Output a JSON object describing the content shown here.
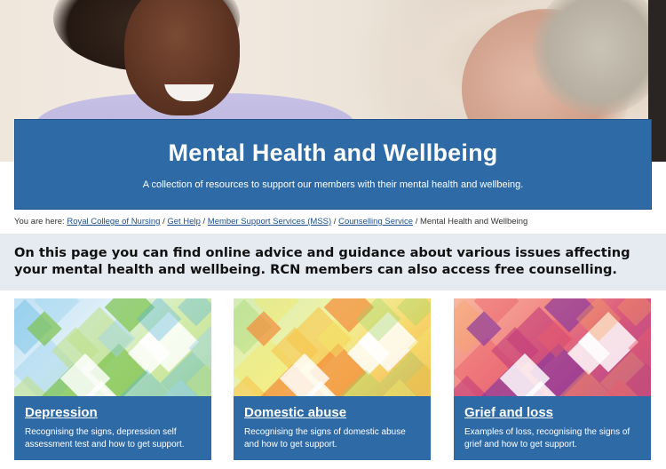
{
  "hero": {
    "title": "Mental Health and Wellbeing",
    "subtitle": "A collection of resources to support our members with their mental health and wellbeing.",
    "banner_color": "#2e6aa6"
  },
  "breadcrumb": {
    "prefix": "You are here:",
    "items": [
      {
        "label": "Royal College of Nursing",
        "link": true
      },
      {
        "label": "Get Help",
        "link": true
      },
      {
        "label": "Member Support Services (MSS)",
        "link": true
      },
      {
        "label": "Counselling Service",
        "link": true
      },
      {
        "label": "Mental Health and Wellbeing",
        "link": false
      }
    ]
  },
  "intro": {
    "text": "On this page you can find online advice and guidance about various issues affecting your mental health and wellbeing. RCN members can also access free counselling."
  },
  "cards": [
    {
      "title": "Depression",
      "description": "Recognising the signs, depression self assessment test and how to get support.",
      "palette": [
        "#4fb3e2",
        "#9fd4ef",
        "#bfe08a",
        "#7cc24f",
        "#ffffff"
      ]
    },
    {
      "title": "Domestic abuse",
      "description": "Recognising the signs of domestic abuse and how to get support.",
      "palette": [
        "#9bd46a",
        "#f3e86a",
        "#f7c34a",
        "#f28c3a",
        "#ffffff"
      ]
    },
    {
      "title": "Grief and loss",
      "description": "Examples of loss, recognising the signs of grief and how to get support.",
      "palette": [
        "#f7a25e",
        "#ea5d6b",
        "#c23c7a",
        "#8e3b9b",
        "#ffffff"
      ]
    }
  ]
}
